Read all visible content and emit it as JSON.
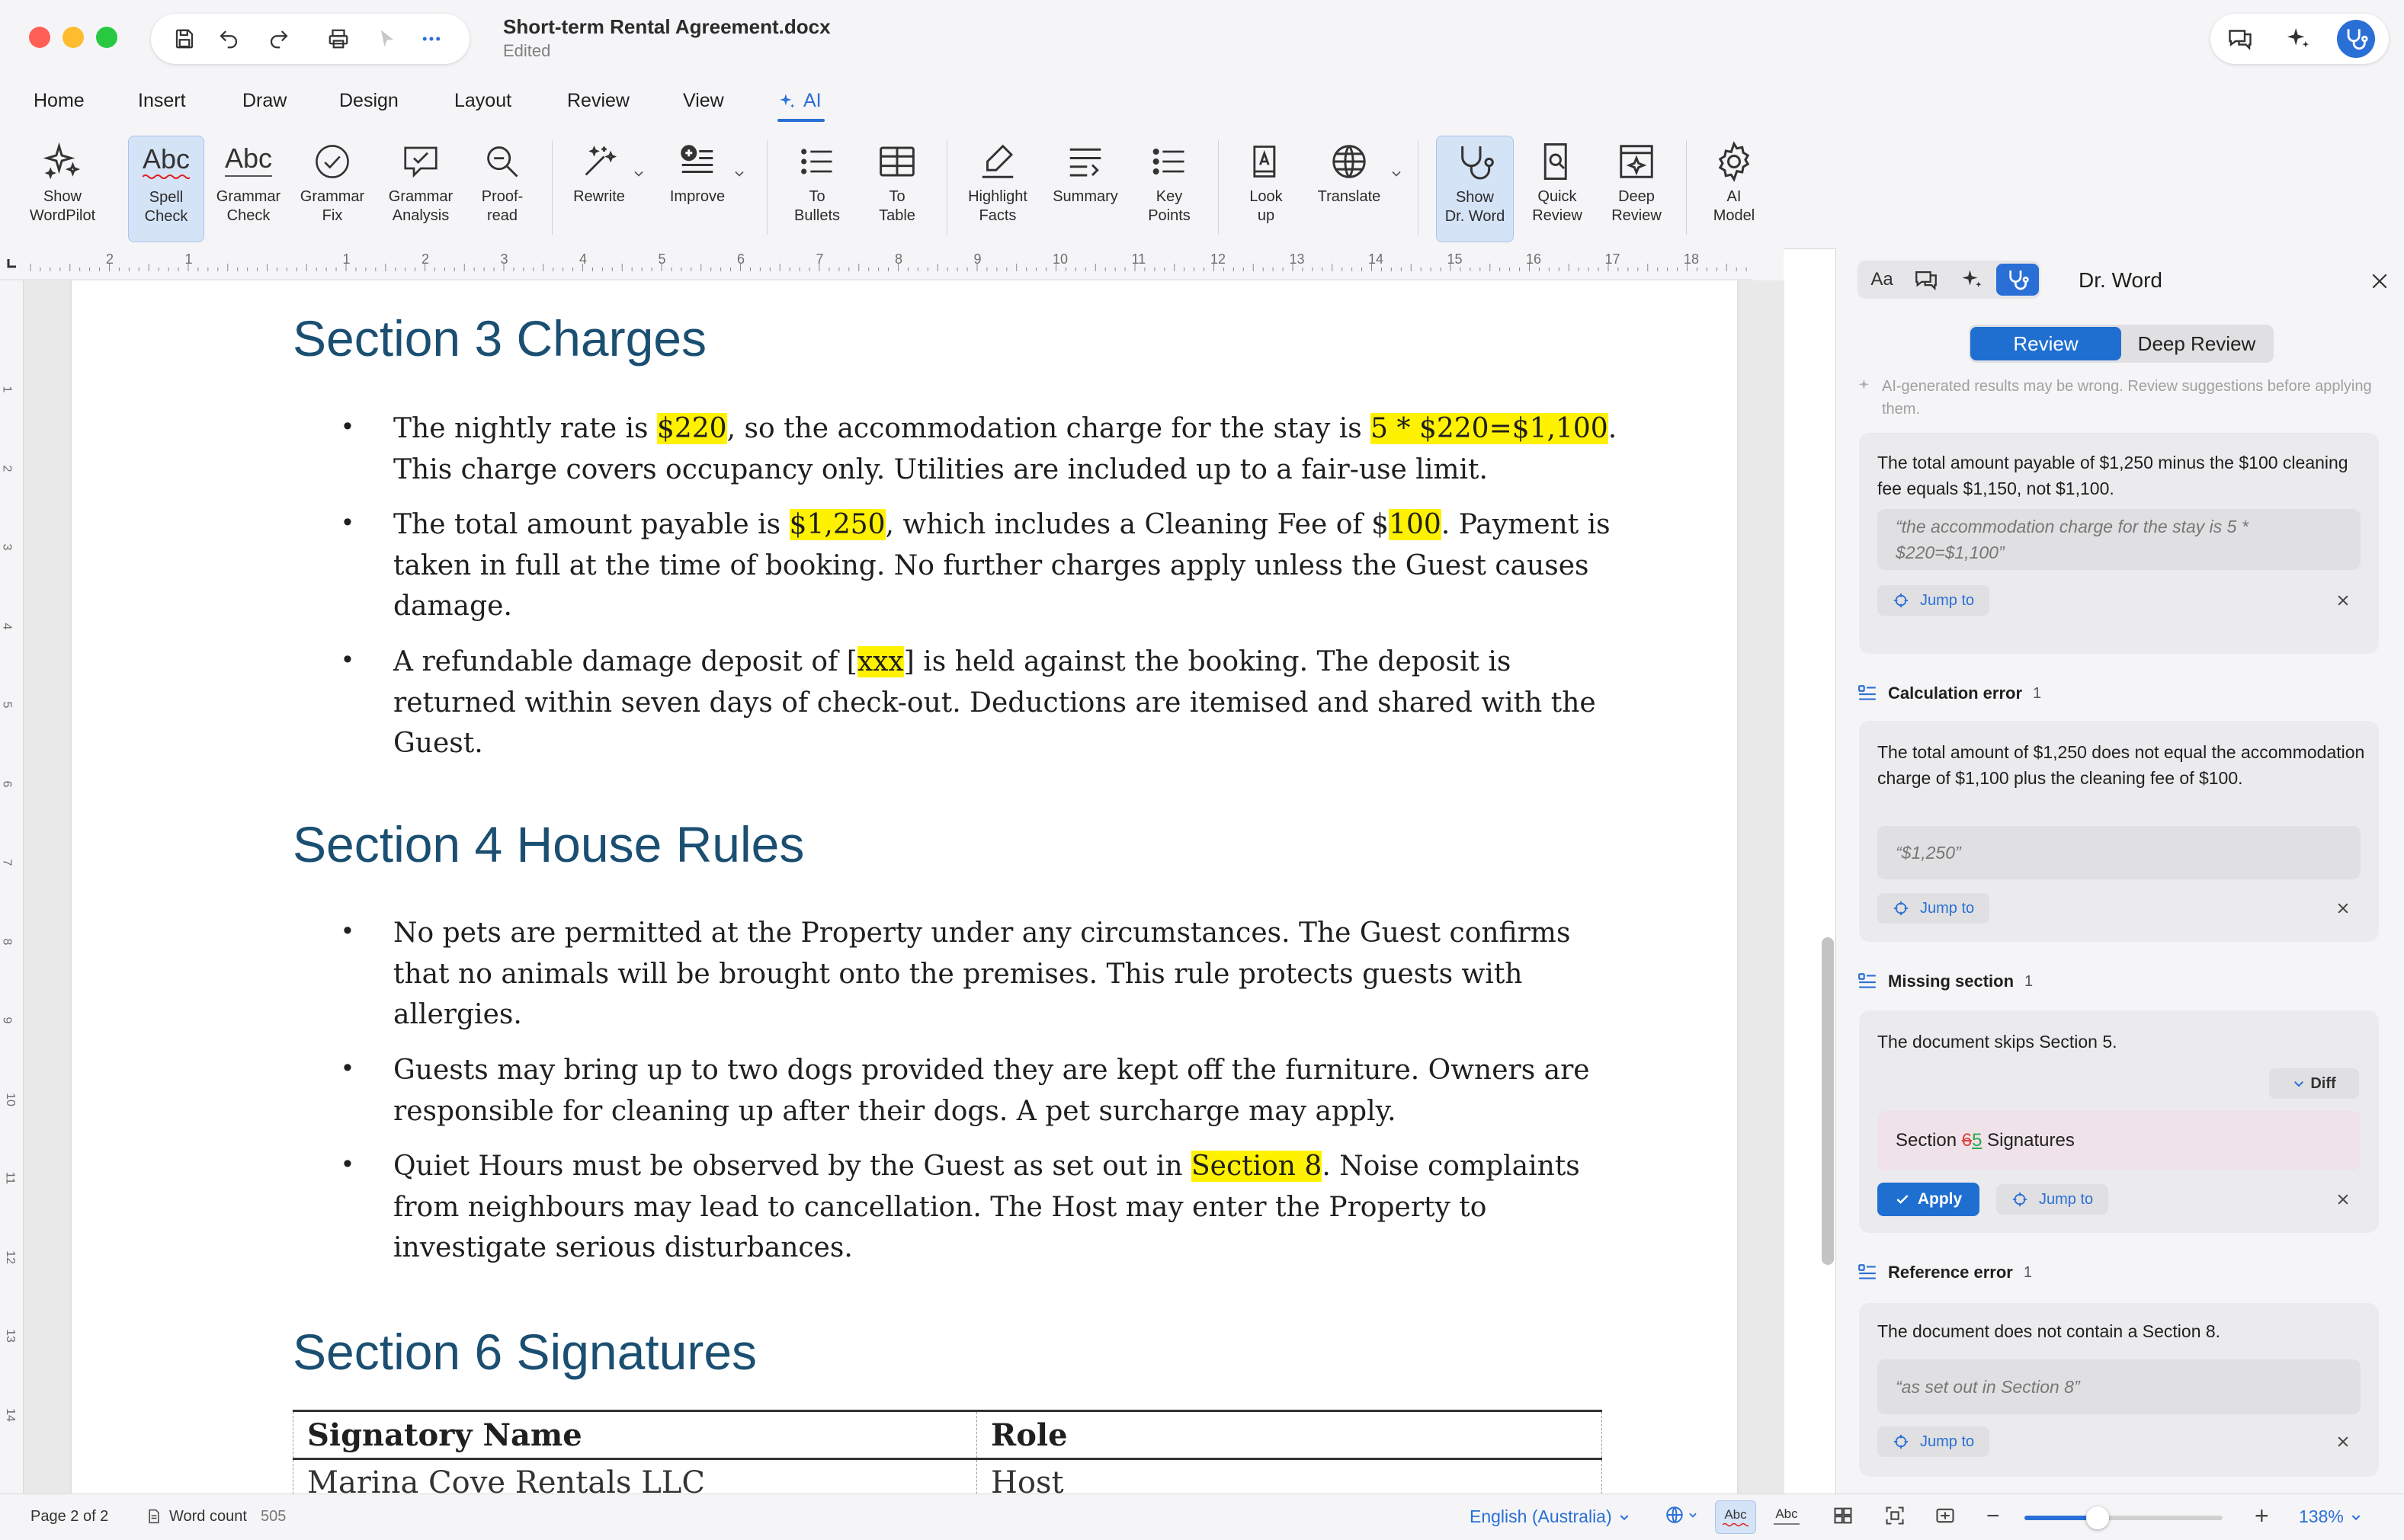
{
  "window": {
    "title": "Short-term Rental Agreement.docx",
    "status": "Edited"
  },
  "tabs": [
    "Home",
    "Insert",
    "Draw",
    "Design",
    "Layout",
    "Review",
    "View",
    "AI"
  ],
  "active_tab": "AI",
  "ribbon": {
    "show_wordpilot": "Show\nWordPilot",
    "spell_check": "Spell\nCheck",
    "grammar_check": "Grammar\nCheck",
    "grammar_fix": "Grammar\nFix",
    "grammar_analysis": "Grammar\nAnalysis",
    "proofread": "Proof-\nread",
    "rewrite": "Rewrite",
    "improve": "Improve",
    "to_bullets": "To\nBullets",
    "to_table": "To\nTable",
    "highlight_facts": "Highlight\nFacts",
    "summary": "Summary",
    "key_points": "Key\nPoints",
    "look_up": "Look\nup",
    "translate": "Translate",
    "show_dr_word": "Show\nDr. Word",
    "quick_review": "Quick\nReview",
    "deep_review": "Deep\nReview",
    "ai_model": "AI\nModel",
    "abc_glyph": "Abc"
  },
  "ruler": {
    "numbers": [
      "2",
      "1",
      "",
      "1",
      "2",
      "3",
      "4",
      "5",
      "6",
      "7",
      "8",
      "9",
      "10",
      "11",
      "12",
      "13",
      "14",
      "15",
      "16",
      "17",
      "18"
    ],
    "vertical": [
      "1",
      "2",
      "3",
      "4",
      "5",
      "6",
      "7",
      "8",
      "9",
      "10",
      "11",
      "12",
      "13",
      "14"
    ]
  },
  "document": {
    "section3_title": "Section 3 Charges",
    "s3_b1": {
      "t1": "The nightly rate is ",
      "h1": "$220",
      "t2": ", so the accommodation charge for the stay is ",
      "h2": "5 * $220=$1,100",
      "t3": ". This charge covers occupancy only. Utilities are included up to a fair-use limit."
    },
    "s3_b2": {
      "t1": "The total amount payable is ",
      "h1": "$1,250",
      "t2": ", which includes a Cleaning Fee of $",
      "h2": "100",
      "t3": ". Payment is taken in full at the time of booking. No further charges apply unless the Guest causes damage."
    },
    "s3_b3": {
      "t1": "A refundable damage deposit of [",
      "h1": "xxx",
      "t2": "] is held against the booking. The deposit is returned within seven days of check-out. Deductions are itemised and shared with the Guest."
    },
    "section4_title": "Section 4 House Rules",
    "s4_b1": "No pets are permitted at the Property under any circumstances. The Guest confirms that no animals will be brought onto the premises. This rule protects guests with allergies.",
    "s4_b2": "Guests may bring up to two dogs provided they are kept off the furniture. Owners are responsible for cleaning up after their dogs. A pet surcharge may apply.",
    "s4_b3": {
      "t1": "Quiet Hours must be observed by the Guest as set out in ",
      "h1": "Section 8",
      "t2": ". Noise complaints from neighbours may lead to cancellation. The Host may enter the Property to investigate serious disturbances."
    },
    "section6_title": "Section 6 Signatures",
    "table": {
      "headers": [
        "Signatory Name",
        "Role"
      ],
      "rows": [
        [
          "Marina Cove Rentals LLC",
          "Host"
        ]
      ]
    },
    "bullet": "•"
  },
  "panel": {
    "tab_aa": "Aa",
    "title": "Dr. Word",
    "seg_review": "Review",
    "seg_deep_review": "Deep Review",
    "disclaimer": "AI-generated results may be wrong. Review suggestions before applying them.",
    "jump_to": "Jump to",
    "apply": "Apply",
    "diff": "Diff",
    "card1": {
      "text": "The total amount payable of $1,250 minus the $100 cleaning fee equals $1,150, not $1,100.",
      "quote": "“the accommodation charge for the stay is 5 * $220=$1,100”"
    },
    "cat_calc": {
      "label": "Calculation error",
      "count": "1"
    },
    "card2": {
      "text": "The total amount of $1,250 does not equal the accommodation charge of $1,100 plus the cleaning fee of $100.",
      "quote": "“$1,250”"
    },
    "cat_missing": {
      "label": "Missing section",
      "count": "1"
    },
    "card3": {
      "text": "The document skips Section 5.",
      "diff_prefix": "Section ",
      "diff_del": "6",
      "diff_ins": "5",
      "diff_suffix": " Signatures"
    },
    "cat_ref": {
      "label": "Reference error",
      "count": "1"
    },
    "card4": {
      "text": "The document does not contain a Section 8.",
      "quote": "“as set out in Section 8”"
    }
  },
  "statusbar": {
    "page": "Page 2 of 2",
    "word_count_label": "Word count",
    "word_count": "505",
    "language": "English (Australia)",
    "zoom": "138%",
    "abc": "Abc",
    "zoom_fraction": 0.37
  },
  "colors": {
    "accent": "#2a6fd6",
    "heading": "#1b4f72",
    "highlight": "#fff200",
    "close": "#ff5f57",
    "minimize": "#febc2e",
    "maximize": "#28c840"
  }
}
